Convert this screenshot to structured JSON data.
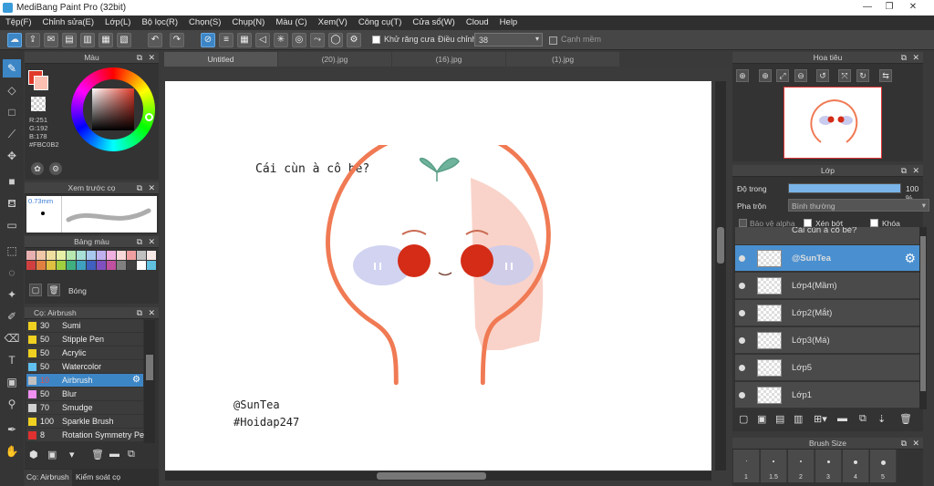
{
  "window": {
    "title": "MediBang Paint Pro (32bit)"
  },
  "menu": [
    "Tệp(F)",
    "Chỉnh sửa(E)",
    "Lớp(L)",
    "Bộ lọc(R)",
    "Chọn(S)",
    "Chụp(N)",
    "Màu (C)",
    "Xem(V)",
    "Công cụ(T)",
    "Cửa sổ(W)",
    "Cloud",
    "Help"
  ],
  "toolbar": {
    "antialias_label": "Khử răng cưa",
    "adjust_label": "Điều chỉnh",
    "adjust_value": "38",
    "edge_label": "Cạnh mềm"
  },
  "color_panel": {
    "title": "Màu",
    "r": "R:251",
    "g": "G:192",
    "b": "B:178",
    "hex": "#FBC0B2"
  },
  "preview_panel": {
    "title": "Xem trước cọ",
    "size": "0.73mm"
  },
  "palette_panel": {
    "title": "Bảng màu",
    "shadow_label": "Bóng",
    "colors": [
      "#e8b0b0",
      "#f0c8a8",
      "#f0e0a0",
      "#e8f0a8",
      "#b8e8b0",
      "#a8e0d8",
      "#a8c8f0",
      "#c0b0f0",
      "#f0b0e0",
      "#f8d8d8",
      "#f0a0a0",
      "#c0c0c0",
      "#f8e8e8",
      "#d04040",
      "#e08040",
      "#e0c040",
      "#a0d040",
      "#40b080",
      "#40a0c0",
      "#4060c0",
      "#8050c0",
      "#c050a0",
      "#808080",
      "#404040",
      "#ffffff",
      "#60c0e0"
    ]
  },
  "brush_panel": {
    "title": "Cọ: Airbrush",
    "brushes": [
      {
        "size": "30",
        "name": "Sumi",
        "color": "#f0d020"
      },
      {
        "size": "50",
        "name": "Stipple Pen",
        "color": "#f0d020"
      },
      {
        "size": "50",
        "name": "Acrylic",
        "color": "#f0d020"
      },
      {
        "size": "50",
        "name": "Watercolor",
        "color": "#60c0f0"
      },
      {
        "size": "10",
        "name": "Airbrush",
        "color": "#c0c0c0"
      },
      {
        "size": "50",
        "name": "Blur",
        "color": "#f090f0"
      },
      {
        "size": "70",
        "name": "Smudge",
        "color": "#d0d0d0"
      },
      {
        "size": "100",
        "name": "Sparkle Brush",
        "color": "#f0d020"
      },
      {
        "size": "8",
        "name": "Rotation Symmetry Pen",
        "color": "#e03030"
      }
    ],
    "tab1": "Cọ: Airbrush",
    "tab2": "Kiểm soát cọ"
  },
  "tabs": [
    "Untitled",
    "(20).jpg",
    "(16).jpg",
    "(1).jpg"
  ],
  "canvas": {
    "question": "Cái cùn à cô bé?",
    "sig1": "@SunTea",
    "sig2": "#Hoidap247"
  },
  "navigator": {
    "title": "Hoa tiêu"
  },
  "layer_panel": {
    "title": "Lớp",
    "opacity_label": "Độ trong",
    "opacity_value": "100 %",
    "blend_label": "Pha trộn",
    "blend_value": "Bình thường",
    "protect_alpha": "Bảo vệ alpha",
    "clip": "Xén bớt",
    "lock": "Khóa",
    "partial_top": "Cái cùn à cô bé?",
    "layers": [
      "@SunTea",
      "Lớp4(Mầm)",
      "Lớp2(Mắt)",
      "Lớp3(Má)",
      "Lớp5",
      "Lớp1"
    ]
  },
  "brush_size_panel": {
    "title": "Brush Size",
    "sizes": [
      "1",
      "1.5",
      "2",
      "3",
      "4",
      "5"
    ]
  }
}
